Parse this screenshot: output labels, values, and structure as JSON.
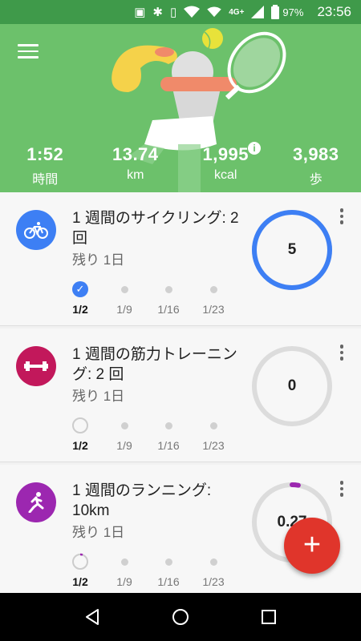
{
  "status_bar": {
    "network": "4G+",
    "battery": "97%",
    "time": "23:56"
  },
  "stats": [
    {
      "value": "1:52",
      "label": "時間"
    },
    {
      "value": "13.74",
      "label": "km"
    },
    {
      "value": "1,995",
      "label": "kcal"
    },
    {
      "value": "3,983",
      "label": "歩"
    }
  ],
  "goals": [
    {
      "title": "1 週間のサイクリング: 2 回",
      "remaining": "残り 1日",
      "progress_value": "5",
      "progress_fraction": 1.0,
      "icon": "bike-icon",
      "color": "#3d7ff4",
      "weeks": [
        {
          "label": "1/2",
          "state": "done"
        },
        {
          "label": "1/9",
          "state": "future"
        },
        {
          "label": "1/16",
          "state": "future"
        },
        {
          "label": "1/23",
          "state": "future"
        }
      ]
    },
    {
      "title": "1 週間の筋力トレーニング: 2 回",
      "remaining": "残り 1日",
      "progress_value": "0",
      "progress_fraction": 0.0,
      "icon": "dumbbell-icon",
      "color": "#c2185b",
      "weeks": [
        {
          "label": "1/2",
          "state": "empty"
        },
        {
          "label": "1/9",
          "state": "future"
        },
        {
          "label": "1/16",
          "state": "future"
        },
        {
          "label": "1/23",
          "state": "future"
        }
      ]
    },
    {
      "title": "1 週間のランニング: 10km",
      "remaining": "残り 1日",
      "progress_value": "0.27",
      "progress_fraction": 0.027,
      "icon": "running-icon",
      "color": "#9c27b0",
      "weeks": [
        {
          "label": "1/2",
          "state": "partial"
        },
        {
          "label": "1/9",
          "state": "future"
        },
        {
          "label": "1/16",
          "state": "future"
        },
        {
          "label": "1/23",
          "state": "future"
        }
      ]
    }
  ],
  "colors": {
    "header": "#6cc16b",
    "status_bar": "#3f9a4a",
    "fab": "#e0352b"
  }
}
